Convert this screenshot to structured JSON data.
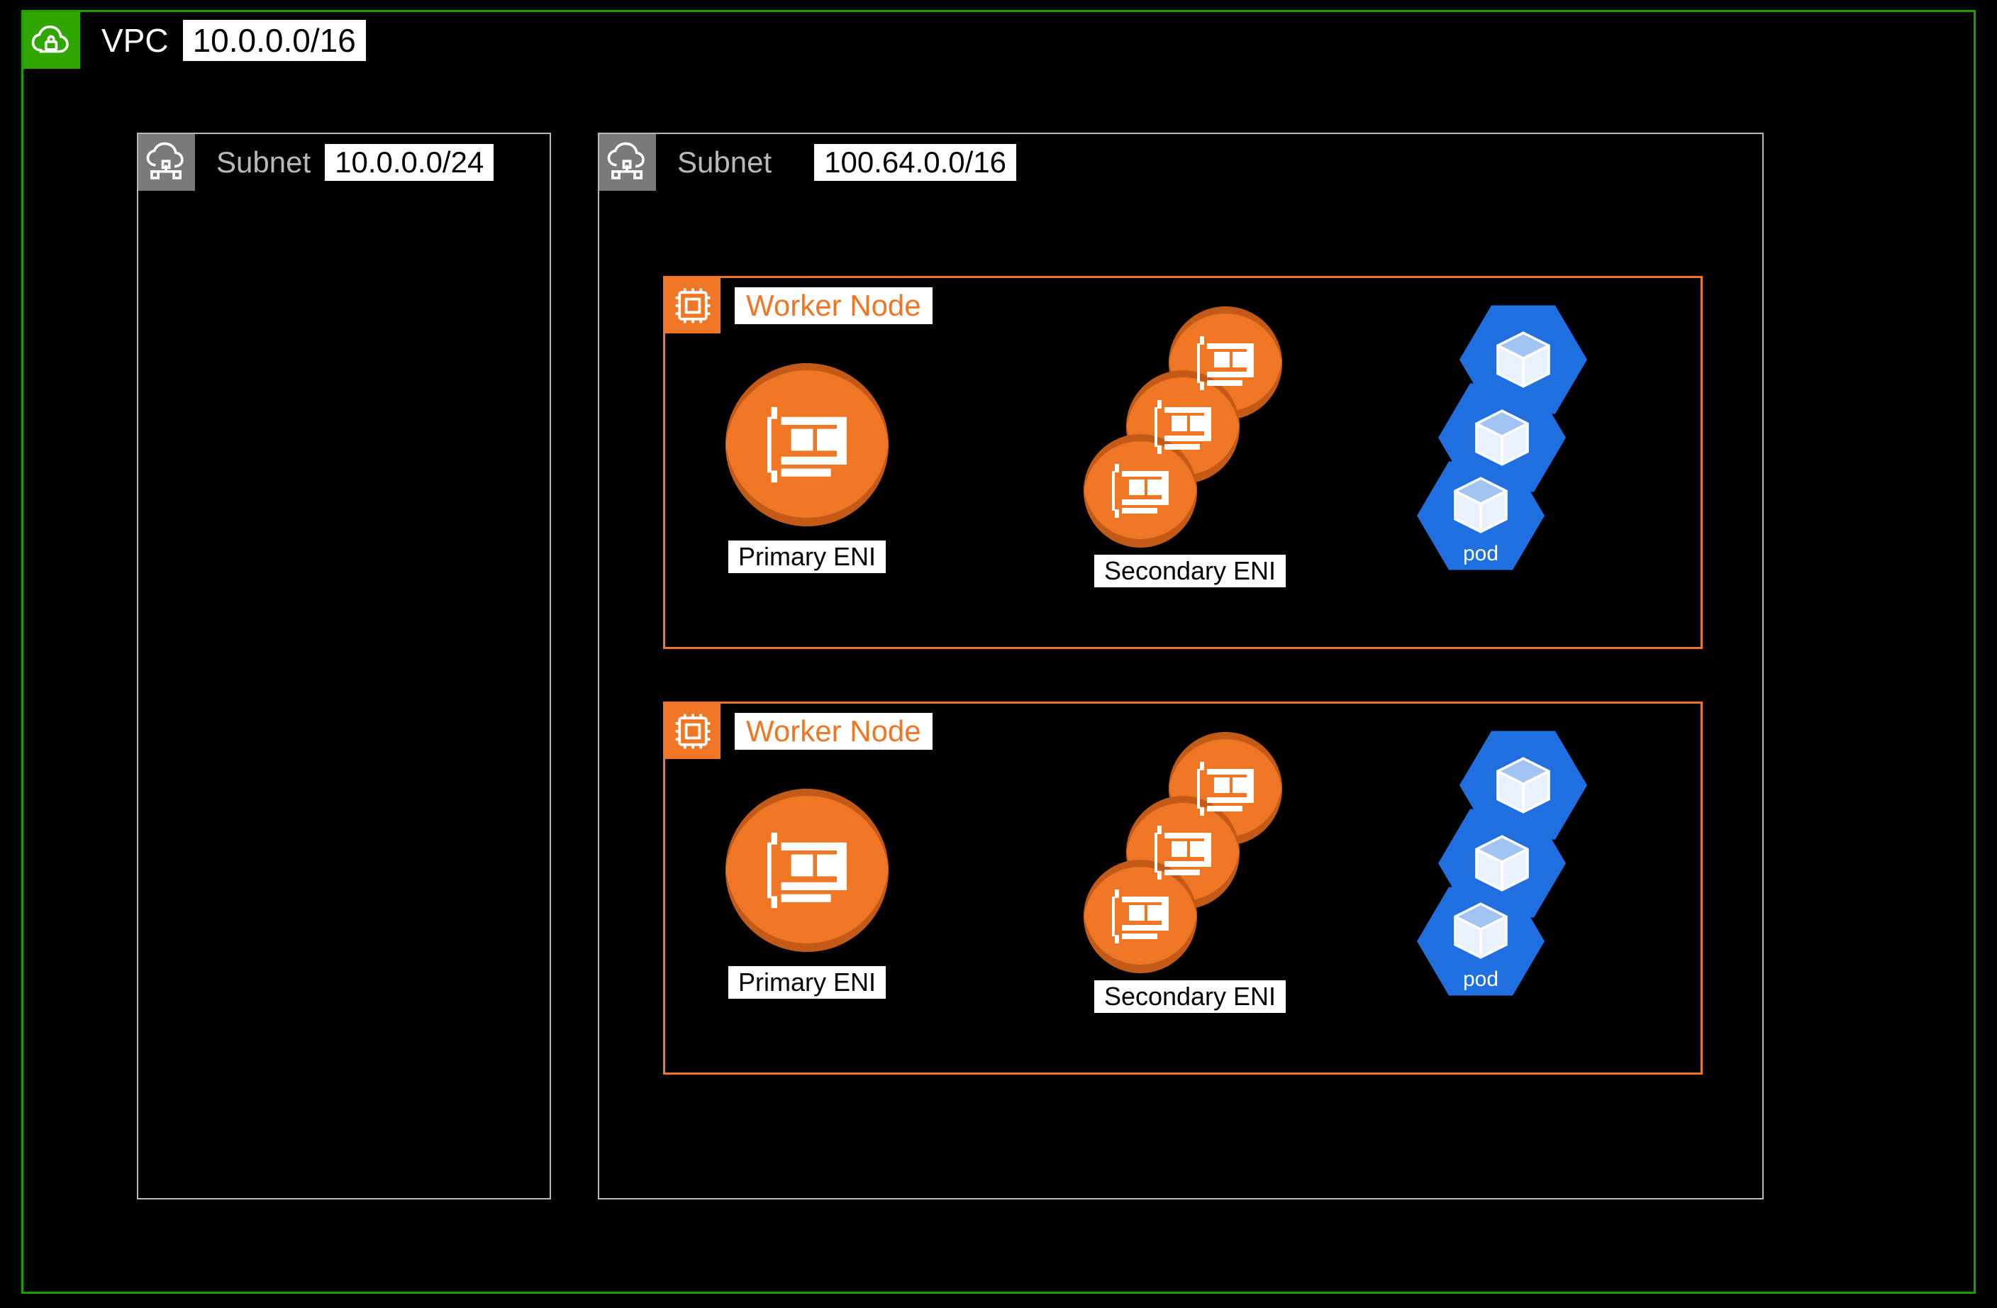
{
  "vpc": {
    "label": "VPC",
    "cidr": "10.0.0.0/16"
  },
  "subnets": [
    {
      "label": "Subnet",
      "cidr": "10.0.0.0/24"
    },
    {
      "label": "Subnet",
      "cidr": "100.64.0.0/16"
    }
  ],
  "worker_nodes": [
    {
      "label": "Worker Node",
      "primary_eni_label": "Primary ENI",
      "secondary_eni_label": "Secondary ENI",
      "pod_label": "pod"
    },
    {
      "label": "Worker Node",
      "primary_eni_label": "Primary ENI",
      "secondary_eni_label": "Secondary ENI",
      "pod_label": "pod"
    }
  ],
  "colors": {
    "vpc_border": "#15a000",
    "vpc_icon_bg": "#31a500",
    "subnet_border": "#b9b9b9",
    "subnet_icon_bg": "#7a7a7a",
    "node_border": "#ee7624",
    "eni_fill": "#ee7624",
    "pod_fill": "#1f6fe0"
  }
}
